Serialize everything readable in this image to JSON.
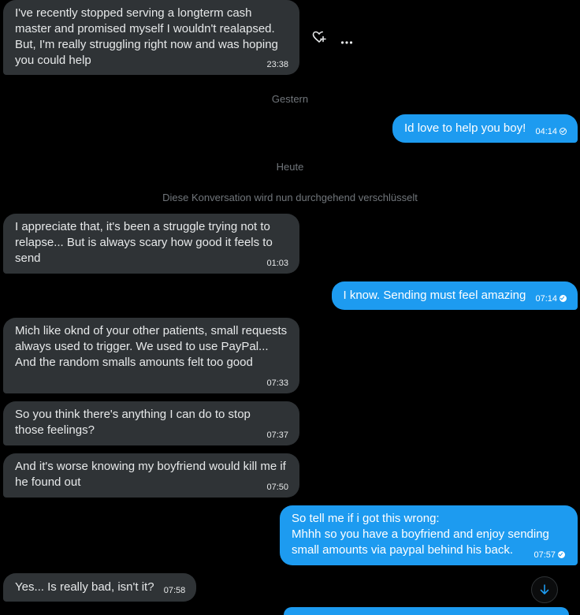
{
  "messages": [
    {
      "text": "I've recently stopped serving a longterm cash master and promised myself I wouldn't realapsed. But, I'm really struggling right now and was hoping you could help",
      "time": "23:38"
    },
    {
      "text": "Id love to help you boy!",
      "time": "04:14"
    },
    {
      "text": "I appreciate that, it's been a struggle trying not to relapse... But is always scary how good it feels to send",
      "time": "01:03"
    },
    {
      "text": "I know. Sending must feel amazing",
      "time": "07:14"
    },
    {
      "text": "Mich like oknd of your other patients, small requests always used to trigger. We used to use PayPal... And the random smalls amounts felt too good",
      "time": "07:33"
    },
    {
      "text": "So you think there's anything I can do to stop those feelings?",
      "time": "07:37"
    },
    {
      "text": "And it's worse knowing my boyfriend would kill me if he found out",
      "time": "07:50"
    },
    {
      "text": "So tell me if i got this wrong:\nMhhh so you have a boyfriend and enjoy sending small amounts via paypal behind his back.",
      "time": "07:57"
    },
    {
      "text": "Yes... Is really bad, isn't it?",
      "time": "07:58"
    }
  ],
  "separators": {
    "yesterday": "Gestern",
    "today": "Heute",
    "encryption_notice": "Diese Konversation wird nun durchgehend verschlüsselt"
  },
  "icons": {
    "react": "heart-plus-icon",
    "more": "more-dots-icon",
    "sent": "check-circle-outline-icon",
    "read": "check-circle-filled-icon",
    "scroll": "arrow-down-icon"
  },
  "colors": {
    "background": "#000000",
    "incoming_bubble": "#2f3336",
    "outgoing_bubble": "#1d9bf0",
    "muted_text": "#71767b"
  }
}
